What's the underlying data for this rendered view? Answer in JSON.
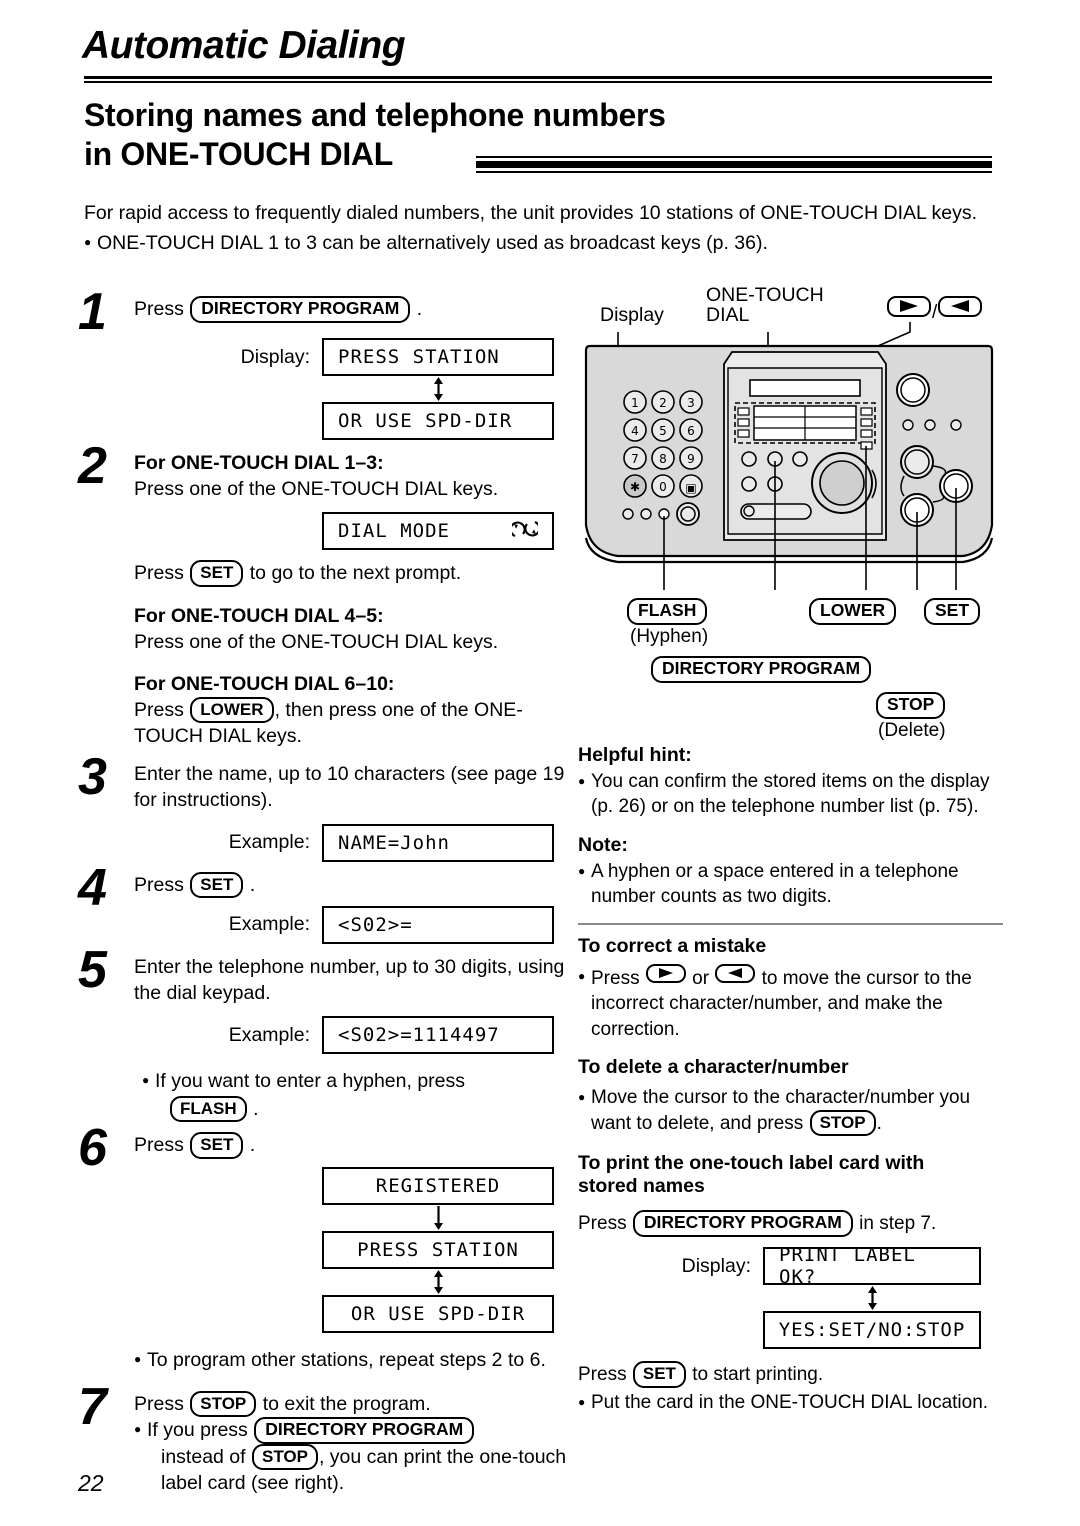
{
  "header": {
    "chapter_title": "Automatic Dialing",
    "section_title_line1": "Storing names and telephone numbers",
    "section_title_line2": "in ONE-TOUCH DIAL"
  },
  "intro": {
    "paragraph": "For rapid access to frequently dialed numbers, the unit provides 10 stations of ONE-TOUCH DIAL keys.",
    "bullet": "ONE-TOUCH DIAL 1 to 3 can be alternatively used as broadcast keys (p. 36)."
  },
  "keys": {
    "directory_program": "DIRECTORY PROGRAM",
    "set": "SET",
    "stop": "STOP",
    "lower": "LOWER",
    "flash": "FLASH"
  },
  "labels": {
    "display": "Display:",
    "example": "Example:",
    "press": "Press",
    "or": "or"
  },
  "steps": [
    {
      "num": "1",
      "text_before": "Press",
      "text_after": ".",
      "displays": [
        "PRESS STATION",
        "OR USE SPD-DIR"
      ]
    },
    {
      "num": "2",
      "heading_1": "For ONE-TOUCH DIAL 1–3:",
      "body_1": "Press one of the ONE-TOUCH DIAL keys.",
      "display_text": "DIAL MODE",
      "display_icon": "cyclic-arrows-icon",
      "after_display": "to go to the next prompt.",
      "heading_2": "For ONE-TOUCH DIAL 4–5:",
      "body_2": "Press one of the ONE-TOUCH DIAL keys.",
      "heading_3": "For ONE-TOUCH DIAL 6–10:",
      "body_3a": ", then press one of the ONE-",
      "body_3b": "TOUCH DIAL keys."
    },
    {
      "num": "3",
      "body": "Enter the name, up to 10 characters (see page 19 for instructions).",
      "example": "NAME=John"
    },
    {
      "num": "4",
      "text_before": "Press",
      "text_after": ".",
      "example": "<S02>="
    },
    {
      "num": "5",
      "body": "Enter the telephone number, up to 30 digits, using the dial keypad.",
      "example": "<S02>=1114497",
      "bullet_a": "If you want to enter a hyphen, press",
      "bullet_b": "."
    },
    {
      "num": "6",
      "text_before": "Press",
      "text_after": ".",
      "displays": [
        "REGISTERED",
        "PRESS STATION",
        "OR USE SPD-DIR"
      ],
      "bullet": "To program other stations, repeat steps 2 to 6."
    },
    {
      "num": "7",
      "line1_before": "Press",
      "line1_after": "to exit the program.",
      "bullet_a": "If you press",
      "bullet_b": "instead of",
      "bullet_c": ", you can print the one-touch label card (see right)."
    }
  ],
  "device": {
    "callouts": {
      "display": "Display",
      "one_touch_dial_l1": "ONE-TOUCH",
      "one_touch_dial_l2": "DIAL",
      "cursor_keys_separator": "/"
    },
    "button_labels": {
      "flash": "FLASH",
      "flash_sub": "(Hyphen)",
      "lower": "LOWER",
      "set": "SET",
      "directory_program": "DIRECTORY PROGRAM",
      "stop": "STOP",
      "stop_sub": "(Delete)"
    },
    "keypad": [
      "1",
      "2",
      "3",
      "4",
      "5",
      "6",
      "7",
      "8",
      "9",
      "✱",
      "0",
      "▣"
    ]
  },
  "right_column": {
    "helpful_hint_title": "Helpful hint:",
    "helpful_hint_body": "You can confirm the stored items on the display (p. 26) or on the telephone number list (p. 75).",
    "note_title": "Note:",
    "note_body": "A hyphen or a space entered in a telephone number counts as two digits.",
    "correct_title": "To correct a mistake",
    "correct_body_a": "Press",
    "correct_body_b": "or",
    "correct_body_c": "to move the cursor to the incorrect character/number, and make the correction.",
    "delete_title": "To delete a character/number",
    "delete_body_a": "Move the cursor to the character/number you want to delete, and press",
    "delete_body_b": ".",
    "print_title_l1": "To print the one-touch label card with",
    "print_title_l2": "stored names",
    "print_press_before": "Press",
    "print_press_after": "in step 7.",
    "print_display_label": "Display:",
    "print_displays": [
      "PRINT LABEL OK?",
      "YES:SET/NO:STOP"
    ],
    "print_set_before": "Press",
    "print_set_after": "to start printing.",
    "print_bullet": "Put the card in the ONE-TOUCH DIAL location."
  },
  "page_number": "22"
}
